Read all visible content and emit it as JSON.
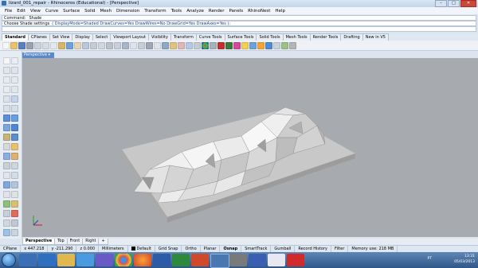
{
  "window": {
    "title": "lizard_001_repair - Rhinoceros (Educational) - [Perspective]",
    "min": "–",
    "max": "□",
    "close": "✕"
  },
  "menu": [
    "File",
    "Edit",
    "View",
    "Curve",
    "Surface",
    "Solid",
    "Mesh",
    "Dimension",
    "Transform",
    "Tools",
    "Analyze",
    "Render",
    "Panels",
    "RhinoNest",
    "Help"
  ],
  "command": {
    "history": "Command: _Shade",
    "prompt": "Choose Shade settings",
    "options": "( DisplayMode=Shaded  DrawCurves=Yes  DrawWires=No  DrawGrid=Yes  DrawAxes=Yes ):",
    "input": ""
  },
  "tabs": [
    "Standard",
    "CPlanes",
    "Set View",
    "Display",
    "Select",
    "Viewport Layout",
    "Visibility",
    "Transform",
    "Curve Tools",
    "Surface Tools",
    "Solid Tools",
    "Mesh Tools",
    "Render Tools",
    "Drafting",
    "New in V5"
  ],
  "active_tab": "Standard",
  "viewport": {
    "label": "Perspective ▾"
  },
  "view_tabs": [
    "Perspective",
    "Top",
    "Front",
    "Right",
    "+"
  ],
  "status": {
    "cplane": "CPlane",
    "x": "x 447.218",
    "y": "y -211.290",
    "z": "z 0.000",
    "units": "Millimeters",
    "layer": "Default",
    "grid_snap": "Grid Snap",
    "ortho": "Ortho",
    "planar": "Planar",
    "osnap": "Osnap",
    "smarttrack": "SmartTrack",
    "gumball": "Gumball",
    "record_history": "Record History",
    "filter": "Filter",
    "memory": "Memory use: 218 MB"
  },
  "taskbar": {
    "lang": "PT",
    "time": "13:31",
    "date": "05/03/2013"
  },
  "colors": {
    "viewport_bg": "#a7aaae",
    "accent": "#5a88c8"
  }
}
